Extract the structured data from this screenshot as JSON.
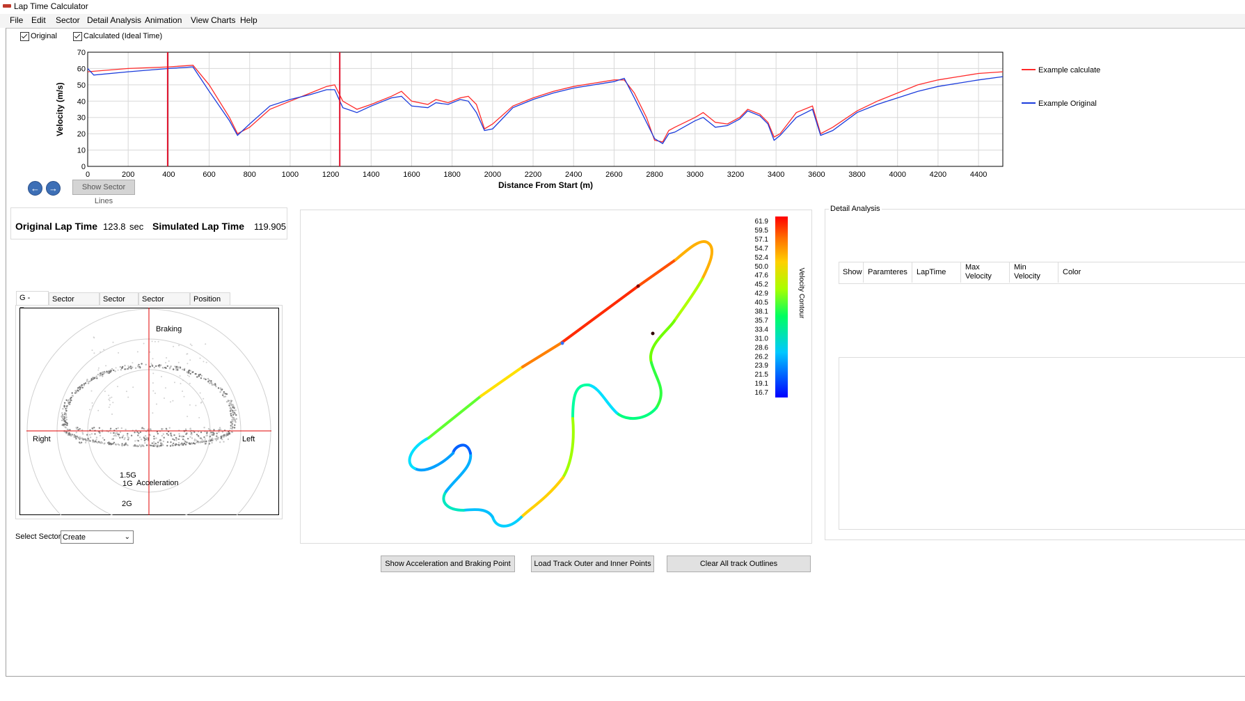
{
  "window": {
    "title": "Lap Time Calculator"
  },
  "menu": [
    "File",
    "Edit",
    "Sector",
    "Detail Analysis",
    "Animation",
    "View Charts",
    "Help"
  ],
  "legend_toggles": {
    "original": "Original",
    "calculated": "Calculated (Ideal Time)"
  },
  "velocity_chart": {
    "ylabel": "Velocity (m/s)",
    "xlabel": "Distance From Start (m)",
    "y_ticks": [
      "0",
      "10",
      "20",
      "30",
      "40",
      "50",
      "60",
      "70"
    ],
    "x_ticks": [
      "0",
      "200",
      "400",
      "600",
      "800",
      "1000",
      "1200",
      "1400",
      "1600",
      "1800",
      "2000",
      "2200",
      "2400",
      "2600",
      "2800",
      "3000",
      "3200",
      "3400",
      "3600",
      "3800",
      "4000",
      "4200",
      "4400"
    ],
    "legend": [
      "Example calculate",
      "Example Original"
    ]
  },
  "chart_data": {
    "type": "line",
    "xlabel": "Distance From Start (m)",
    "ylabel": "Velocity (m/s)",
    "xlim": [
      0,
      4520
    ],
    "ylim": [
      0,
      70
    ],
    "grid": true,
    "legend_position": "right",
    "sector_lines": [
      395,
      1245
    ],
    "series": [
      {
        "name": "Example calculate",
        "color": "#ff2a2a",
        "x": [
          0,
          200,
          400,
          520,
          600,
          700,
          740,
          800,
          900,
          1000,
          1100,
          1180,
          1220,
          1260,
          1330,
          1400,
          1500,
          1550,
          1600,
          1680,
          1720,
          1780,
          1840,
          1880,
          1920,
          1960,
          2000,
          2100,
          2200,
          2300,
          2400,
          2500,
          2600,
          2650,
          2700,
          2760,
          2800,
          2840,
          2870,
          2900,
          3000,
          3040,
          3100,
          3160,
          3220,
          3260,
          3320,
          3360,
          3390,
          3420,
          3500,
          3580,
          3620,
          3680,
          3800,
          3900,
          4000,
          4100,
          4200,
          4300,
          4400,
          4520
        ],
        "y": [
          58,
          60,
          61,
          62,
          50,
          30,
          20,
          24,
          35,
          40,
          45,
          49,
          50,
          40,
          35,
          38,
          43,
          46,
          40,
          38,
          41,
          39,
          42,
          43,
          38,
          23,
          26,
          37,
          42,
          46,
          49,
          51,
          53,
          53,
          45,
          30,
          16,
          15,
          22,
          24,
          30,
          33,
          27,
          26,
          30,
          35,
          32,
          27,
          18,
          20,
          33,
          37,
          20,
          24,
          34,
          40,
          45,
          50,
          53,
          55,
          57,
          58
        ]
      },
      {
        "name": "Example Original",
        "color": "#1a3bdc",
        "x": [
          0,
          30,
          200,
          400,
          520,
          600,
          700,
          740,
          800,
          900,
          1000,
          1100,
          1180,
          1220,
          1260,
          1330,
          1400,
          1500,
          1550,
          1600,
          1680,
          1720,
          1780,
          1840,
          1880,
          1920,
          1960,
          2000,
          2100,
          2200,
          2300,
          2400,
          2500,
          2600,
          2650,
          2700,
          2760,
          2800,
          2840,
          2870,
          2900,
          3000,
          3040,
          3100,
          3160,
          3220,
          3260,
          3320,
          3360,
          3390,
          3420,
          3500,
          3580,
          3620,
          3680,
          3800,
          3900,
          4000,
          4100,
          4200,
          4300,
          4400,
          4520
        ],
        "y": [
          60,
          56,
          58,
          60,
          61,
          46,
          28,
          19,
          26,
          37,
          41,
          44,
          47,
          47,
          36,
          33,
          37,
          42,
          43,
          37,
          36,
          39,
          38,
          41,
          40,
          33,
          22,
          23,
          36,
          41,
          45,
          48,
          50,
          52,
          54,
          42,
          27,
          17,
          14,
          20,
          21,
          28,
          30,
          24,
          25,
          29,
          34,
          31,
          26,
          16,
          19,
          30,
          35,
          19,
          22,
          33,
          38,
          42,
          46,
          49,
          51,
          53,
          55
        ]
      }
    ]
  },
  "sector_nav": {
    "prev": "←",
    "next": "→",
    "show_sector_lines": "Show Sector Lines"
  },
  "lap_times": {
    "original_label": "Original Lap Time",
    "original_value": "123.8",
    "original_unit": "sec",
    "simulated_label": "Simulated Lap Time",
    "simulated_value": "119.905"
  },
  "tabs": [
    "G -Force",
    "Sector Velocity",
    "Sector Plot",
    "Sector Analysis",
    "Position Info"
  ],
  "gforce": {
    "braking": "Braking",
    "acceleration": "Acceleration",
    "right": "Right",
    "left": "Left",
    "rings": [
      "1G",
      "1.5G",
      "2G"
    ]
  },
  "select_sector": {
    "label": "Select Sector",
    "value": "Create"
  },
  "track_map": {
    "colorbar_title": "Velocity Contour",
    "colorbar_values": [
      "61.9",
      "59.5",
      "57.1",
      "54.7",
      "52.4",
      "50.0",
      "47.6",
      "45.2",
      "42.9",
      "40.5",
      "38.1",
      "35.7",
      "33.4",
      "31.0",
      "28.6",
      "26.2",
      "23.9",
      "21.5",
      "19.1",
      "16.7"
    ]
  },
  "detail_analysis": {
    "title": "Detail Analysis",
    "columns": [
      "Show",
      "Paramteres",
      "LapTime",
      "Max Velocity",
      "Min Velocity",
      "Color"
    ]
  },
  "actions": {
    "show_accel": "Show Acceleration and Braking Point",
    "load_track": "Load Track Outer and Inner Points",
    "clear_outlines": "Clear All track Outlines"
  }
}
